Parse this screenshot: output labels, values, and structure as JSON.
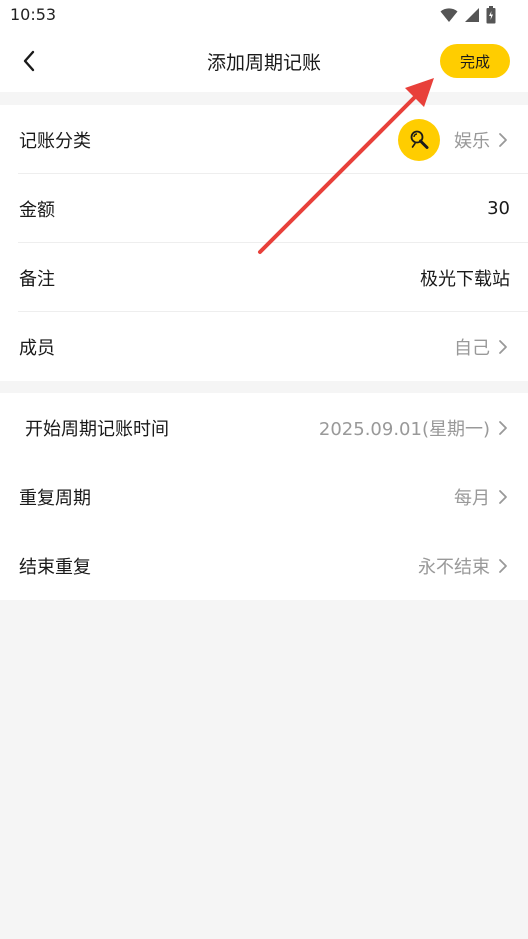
{
  "status_bar": {
    "time": "10:53"
  },
  "nav": {
    "title": "添加周期记账",
    "done_label": "完成"
  },
  "section1": {
    "category": {
      "label": "记账分类",
      "value": "娱乐"
    },
    "amount": {
      "label": "金额",
      "value": "30"
    },
    "note": {
      "label": "备注",
      "value": "极光下载站"
    },
    "member": {
      "label": "成员",
      "value": "自己"
    }
  },
  "section2": {
    "start": {
      "label": "开始周期记账时间",
      "value": "2025.09.01(星期一)"
    },
    "repeat": {
      "label": "重复周期",
      "value": "每月"
    },
    "end": {
      "label": "结束重复",
      "value": "永不结束"
    }
  },
  "colors": {
    "accent": "#ffcd00",
    "annotation_arrow": "#e8403a"
  }
}
